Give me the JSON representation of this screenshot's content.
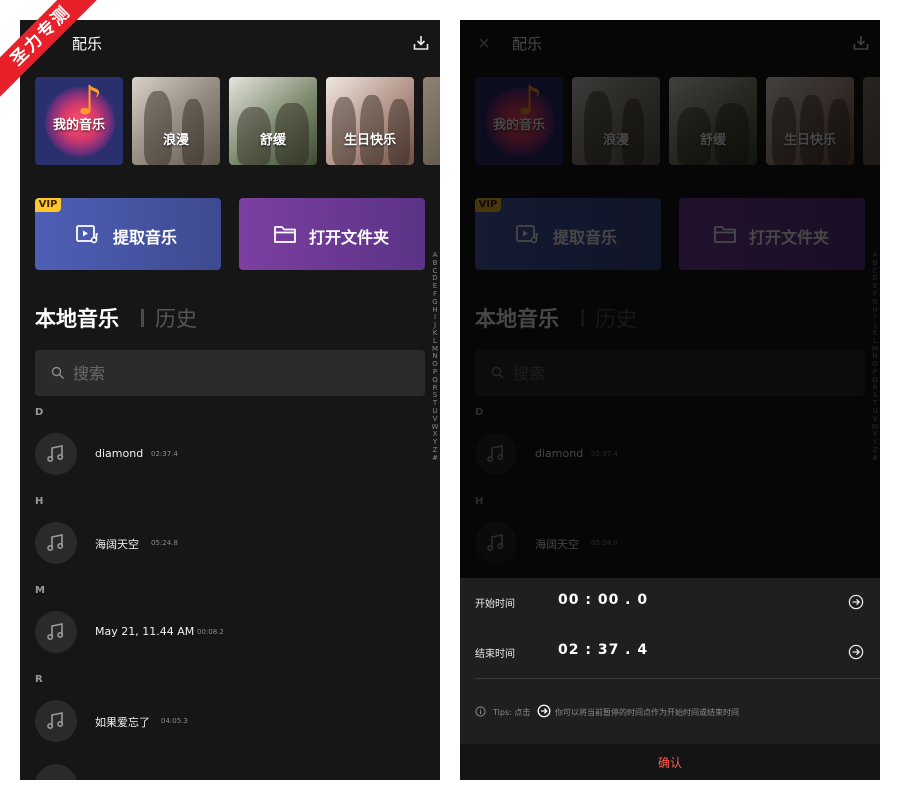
{
  "watermark": "圣力专测",
  "app": {
    "title": "配乐",
    "close_glyph": "✕"
  },
  "categories": [
    {
      "label": "我的音乐"
    },
    {
      "label": "浪漫"
    },
    {
      "label": "舒缓"
    },
    {
      "label": "生日快乐"
    }
  ],
  "actions": {
    "vip": "VIP",
    "extract_label": "提取音乐",
    "folder_label": "打开文件夹"
  },
  "index_letters": "A\nB\nC\nD\nE\nF\nG\nH\nI\nJ\nK\nL\nM\nN\nO\nP\nQ\nR\nS\nT\nU\nV\nW\nX\nY\nZ\n#",
  "tabs": {
    "local": "本地音乐",
    "history": "历史"
  },
  "search": {
    "placeholder": "搜索"
  },
  "groups": [
    {
      "letter": "D",
      "songs": [
        {
          "title": "diamond",
          "duration": "02:37.4"
        }
      ]
    },
    {
      "letter": "H",
      "songs": [
        {
          "title": "海阔天空",
          "duration": "05:24.8"
        }
      ]
    },
    {
      "letter": "M",
      "songs": [
        {
          "title": "May 21, 11.44 AM",
          "duration": "00:08.2"
        }
      ]
    },
    {
      "letter": "R",
      "songs": [
        {
          "title": "如果爱忘了",
          "duration": "04:05.3"
        }
      ]
    }
  ],
  "sheet": {
    "start_label": "开始时间",
    "start_value": "00 : 00 . 0",
    "end_label": "结束时间",
    "end_value": "02 : 37 . 4",
    "tips_prefix": "Tips: 点击",
    "tips_suffix": "你可以将当前暂停的时间点作为开始时间或结束时间",
    "confirm": "确认"
  },
  "colors": {
    "background": "#161616",
    "confirm": "#ff5a4e",
    "vip": "#ffc52e",
    "extract_card": "#4f5fb5",
    "folder_card": "#7d3fa2",
    "watermark": "#e8202a"
  }
}
